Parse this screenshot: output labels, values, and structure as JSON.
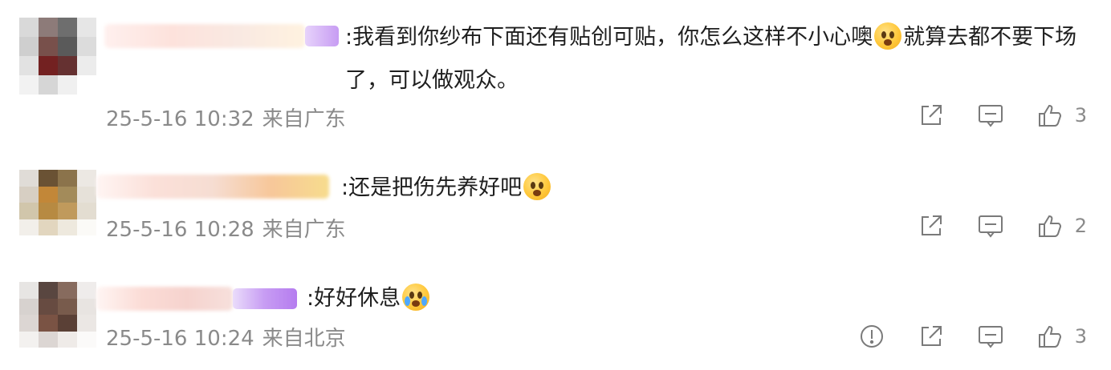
{
  "comments": [
    {
      "text": ":我看到你纱布下面还有贴创可贴，你怎么这样不小心噢",
      "text_after": "就算去都不要下场了，可以做观众。",
      "emoji": "pleading-face-icon",
      "date": "25-5-16 10:32",
      "location": "来自广东",
      "likes": "3"
    },
    {
      "text": ":还是把伤先养好吧",
      "text_after": "",
      "emoji": "pleading-face-icon",
      "date": "25-5-16 10:28",
      "location": "来自广东",
      "likes": "2"
    },
    {
      "text": ":好好休息",
      "text_after": "",
      "emoji": "crying-face-icon",
      "date": "25-5-16 10:24",
      "location": "来自北京",
      "likes": "3"
    }
  ],
  "colors": {
    "text": "#1f1f1f",
    "meta": "#8a8a8a",
    "badge_purple": "#c79cf3"
  }
}
